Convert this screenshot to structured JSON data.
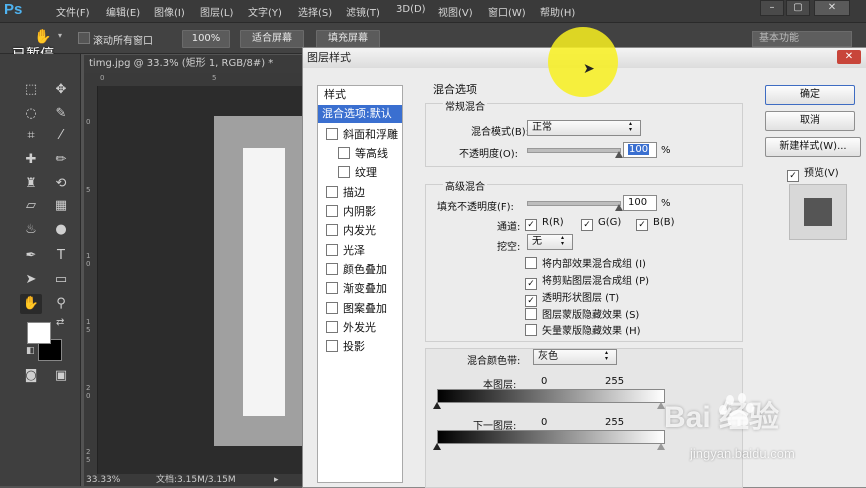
{
  "app": {
    "logo": "Ps",
    "menus": [
      "文件(F)",
      "编辑(E)",
      "图像(I)",
      "图层(L)",
      "文字(Y)",
      "选择(S)",
      "滤镜(T)",
      "3D(D)",
      "视图(V)",
      "窗口(W)",
      "帮助(H)"
    ],
    "window_buttons": [
      "–",
      "▢",
      "✕"
    ]
  },
  "options_bar": {
    "scroll_all_label": "滚动所有窗口",
    "zoom_100": "100%",
    "fit_screen": "适合屏幕",
    "fill_screen": "填充屏幕",
    "workspace": "基本功能"
  },
  "overlay": {
    "paused": "已暂停"
  },
  "document": {
    "tab": "timg.jpg @ 33.3% (矩形 1, RGB/8#) *",
    "ruler_top": [
      "0",
      "5"
    ],
    "ruler_left": [
      "0",
      "5",
      "1 0",
      "1 5",
      "2 0",
      "2 5"
    ],
    "zoom": "33.33%",
    "doc_info": "文档:3.15M/3.15M"
  },
  "dialog": {
    "title": "图层样式",
    "close": "✕",
    "styles_header": "样式",
    "styles": [
      {
        "label": "混合选项:默认",
        "checkbox": false,
        "selected": true,
        "indent": 0
      },
      {
        "label": "斜面和浮雕",
        "checkbox": true,
        "checked": false,
        "indent": 0
      },
      {
        "label": "等高线",
        "checkbox": true,
        "checked": false,
        "indent": 1
      },
      {
        "label": "纹理",
        "checkbox": true,
        "checked": false,
        "indent": 1
      },
      {
        "label": "描边",
        "checkbox": true,
        "checked": false,
        "indent": 0
      },
      {
        "label": "内阴影",
        "checkbox": true,
        "checked": false,
        "indent": 0
      },
      {
        "label": "内发光",
        "checkbox": true,
        "checked": false,
        "indent": 0
      },
      {
        "label": "光泽",
        "checkbox": true,
        "checked": false,
        "indent": 0
      },
      {
        "label": "颜色叠加",
        "checkbox": true,
        "checked": false,
        "indent": 0
      },
      {
        "label": "渐变叠加",
        "checkbox": true,
        "checked": false,
        "indent": 0
      },
      {
        "label": "图案叠加",
        "checkbox": true,
        "checked": false,
        "indent": 0
      },
      {
        "label": "外发光",
        "checkbox": true,
        "checked": false,
        "indent": 0
      },
      {
        "label": "投影",
        "checkbox": true,
        "checked": false,
        "indent": 0
      }
    ],
    "blend_options_title": "混合选项",
    "general": {
      "title": "常规混合",
      "blend_mode_label": "混合模式(B):",
      "blend_mode_value": "正常",
      "opacity_label": "不透明度(O):",
      "opacity_value": "100",
      "opacity_pct": 100,
      "unit": "%"
    },
    "advanced": {
      "title": "高级混合",
      "fill_label": "填充不透明度(F):",
      "fill_value": "100",
      "fill_pct": 100,
      "unit": "%",
      "channels_label": "通道:",
      "channels": [
        {
          "label": "R(R)",
          "checked": true
        },
        {
          "label": "G(G)",
          "checked": true
        },
        {
          "label": "B(B)",
          "checked": true
        }
      ],
      "knockout_label": "挖空:",
      "knockout_value": "无",
      "options": [
        {
          "label": "将内部效果混合成组 (I)",
          "checked": false
        },
        {
          "label": "将剪贴图层混合成组 (P)",
          "checked": true
        },
        {
          "label": "透明形状图层 (T)",
          "checked": true
        },
        {
          "label": "图层蒙版隐藏效果 (S)",
          "checked": false
        },
        {
          "label": "矢量蒙版隐藏效果 (H)",
          "checked": false
        }
      ]
    },
    "blend_if": {
      "label": "混合颜色带:",
      "value": "灰色",
      "this_layer_label": "本图层:",
      "underlying_label": "下一图层:",
      "min": "0",
      "max": "255"
    },
    "buttons": {
      "ok": "确定",
      "cancel": "取消",
      "new_style": "新建样式(W)...",
      "preview": "预览(V)"
    }
  },
  "watermark": {
    "text": "Bai  经验",
    "url": "jingyan.baidu.com"
  }
}
